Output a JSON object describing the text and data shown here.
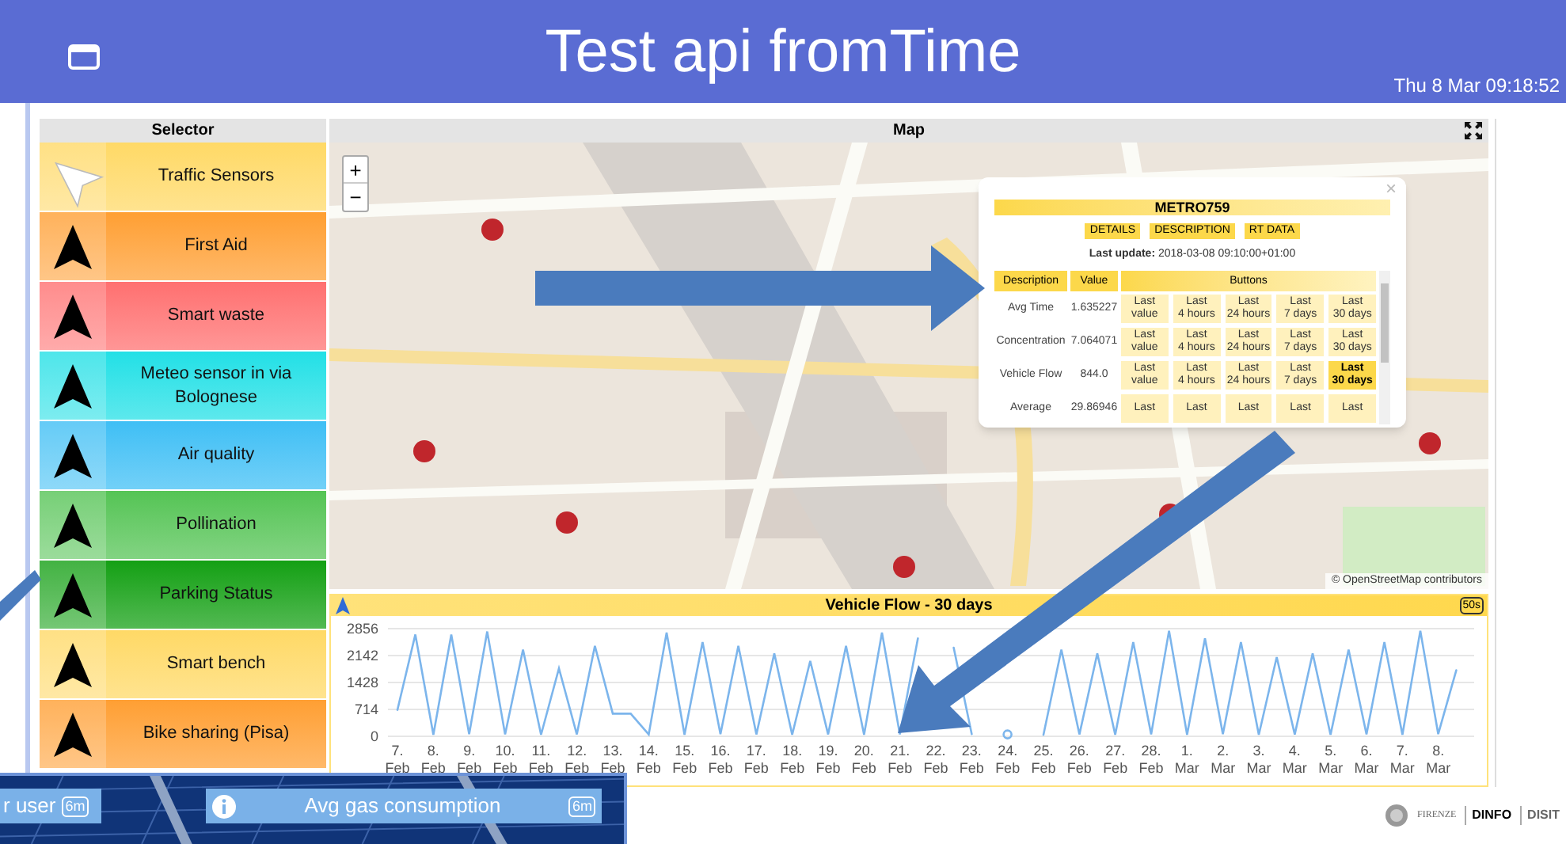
{
  "header": {
    "title": "Test api fromTime",
    "datetime": "Thu 8 Mar 09:18:52"
  },
  "selector": {
    "title": "Selector",
    "items": [
      {
        "label": "Traffic Sensors",
        "color": "#ffd966",
        "selected": true
      },
      {
        "label": "First Aid",
        "color": "#ff9f33",
        "selected": false
      },
      {
        "label": "Smart waste",
        "color": "#ff7070",
        "selected": false
      },
      {
        "label": "Meteo sensor in via Bolognese",
        "color": "#22e0e6",
        "selected": false
      },
      {
        "label": "Air quality",
        "color": "#3fbff5",
        "selected": false
      },
      {
        "label": "Pollination",
        "color": "#55c455",
        "selected": false
      },
      {
        "label": "Parking Status",
        "color": "#14a014",
        "selected": false
      },
      {
        "label": "Smart bench",
        "color": "#ffd966",
        "selected": false
      },
      {
        "label": "Bike sharing (Pisa)",
        "color": "#ff9f33",
        "selected": false
      }
    ]
  },
  "map": {
    "title": "Map",
    "zoom_in": "+",
    "zoom_out": "−",
    "attribution": "© OpenStreetMap contributors",
    "popup": {
      "close": "×",
      "title": "METRO759",
      "tabs": [
        "DETAILS",
        "DESCRIPTION",
        "RT DATA"
      ],
      "last_update": "**Last update:** 2018-03-08 09:10:00+01:00",
      "columns": [
        "Description",
        "Value",
        "Buttons"
      ],
      "rows": [
        {
          "description": "Avg Time",
          "value": "1.635227",
          "buttons": [
            {
              "label": "Last\nvalue",
              "selected": false
            },
            {
              "label": "Last\n4 hours",
              "selected": false
            },
            {
              "label": "Last\n24 hours",
              "selected": false
            },
            {
              "label": "Last\n7 days",
              "selected": false
            },
            {
              "label": "Last\n30 days",
              "selected": false
            }
          ]
        },
        {
          "description": "Concentration",
          "value": "7.064071",
          "buttons": [
            {
              "label": "Last\nvalue",
              "selected": false
            },
            {
              "label": "Last\n4 hours",
              "selected": false
            },
            {
              "label": "Last\n24 hours",
              "selected": false
            },
            {
              "label": "Last\n7 days",
              "selected": false
            },
            {
              "label": "Last\n30 days",
              "selected": false
            }
          ]
        },
        {
          "description": "Vehicle Flow",
          "value": "844.0",
          "buttons": [
            {
              "label": "Last\nvalue",
              "selected": false
            },
            {
              "label": "Last\n4 hours",
              "selected": false
            },
            {
              "label": "Last\n24 hours",
              "selected": false
            },
            {
              "label": "Last\n7 days",
              "selected": false
            },
            {
              "label": "Last\n30 days",
              "selected": true
            }
          ]
        },
        {
          "description": "Average",
          "value": "29.86946",
          "buttons": [
            {
              "label": "Last",
              "selected": false
            },
            {
              "label": "Last",
              "selected": false
            },
            {
              "label": "Last",
              "selected": false
            },
            {
              "label": "Last",
              "selected": false
            },
            {
              "label": "Last",
              "selected": false
            }
          ]
        }
      ]
    }
  },
  "chart_panel": {
    "title": "Vehicle Flow - 30 days",
    "badge": "50s",
    "chart_data": {
      "type": "line",
      "categories": [
        "7. Feb",
        null,
        "8. Feb",
        null,
        "9. Feb",
        null,
        "10. Feb",
        null,
        "11. Feb",
        null,
        "12. Feb",
        null,
        "13. Feb",
        null,
        "14. Feb",
        null,
        "15. Feb",
        null,
        "16. Feb",
        null,
        "17. Feb",
        null,
        "18. Feb",
        null,
        "19. Feb",
        null,
        "20. Feb",
        null,
        "21. Feb",
        null,
        "22. Feb",
        null,
        "23. Feb",
        null,
        "24. Feb",
        null,
        "25. Feb",
        null,
        "26. Feb",
        null,
        "27. Feb",
        null,
        "28. Feb",
        null,
        "1. Mar",
        null,
        "2. Mar",
        null,
        "3. Mar",
        null,
        "4. Mar",
        null,
        "5. Mar",
        null,
        "6. Mar",
        null,
        "7. Mar",
        null,
        "8. Mar",
        null
      ],
      "series": [
        {
          "color": "#7cb5ec",
          "values": [
            700,
            2700,
            40,
            2700,
            60,
            2780,
            50,
            2300,
            40,
            1800,
            50,
            2400,
            600,
            600,
            50,
            2750,
            40,
            2500,
            60,
            2400,
            50,
            2200,
            40,
            2000,
            50,
            2400,
            40,
            2750,
            50,
            2600,
            null,
            2350,
            60,
            null,
            50,
            null,
            40,
            2300,
            50,
            2200,
            40,
            2500,
            50,
            2800,
            40,
            2600,
            60,
            2500,
            40,
            2100,
            50,
            2200,
            40,
            2300,
            50,
            2500,
            40,
            2800,
            60,
            1750
          ]
        }
      ],
      "grid": true,
      "ylim": [
        0,
        2856
      ],
      "yticks": [
        0,
        714,
        1428,
        2142,
        2856
      ]
    }
  },
  "logos": [
    "FIRENZE",
    "DINFO",
    "DISIT"
  ],
  "overlay_widgets": [
    {
      "title": "r user",
      "badge": "6m"
    },
    {
      "title": "Avg gas consumption",
      "badge": "6m"
    }
  ]
}
